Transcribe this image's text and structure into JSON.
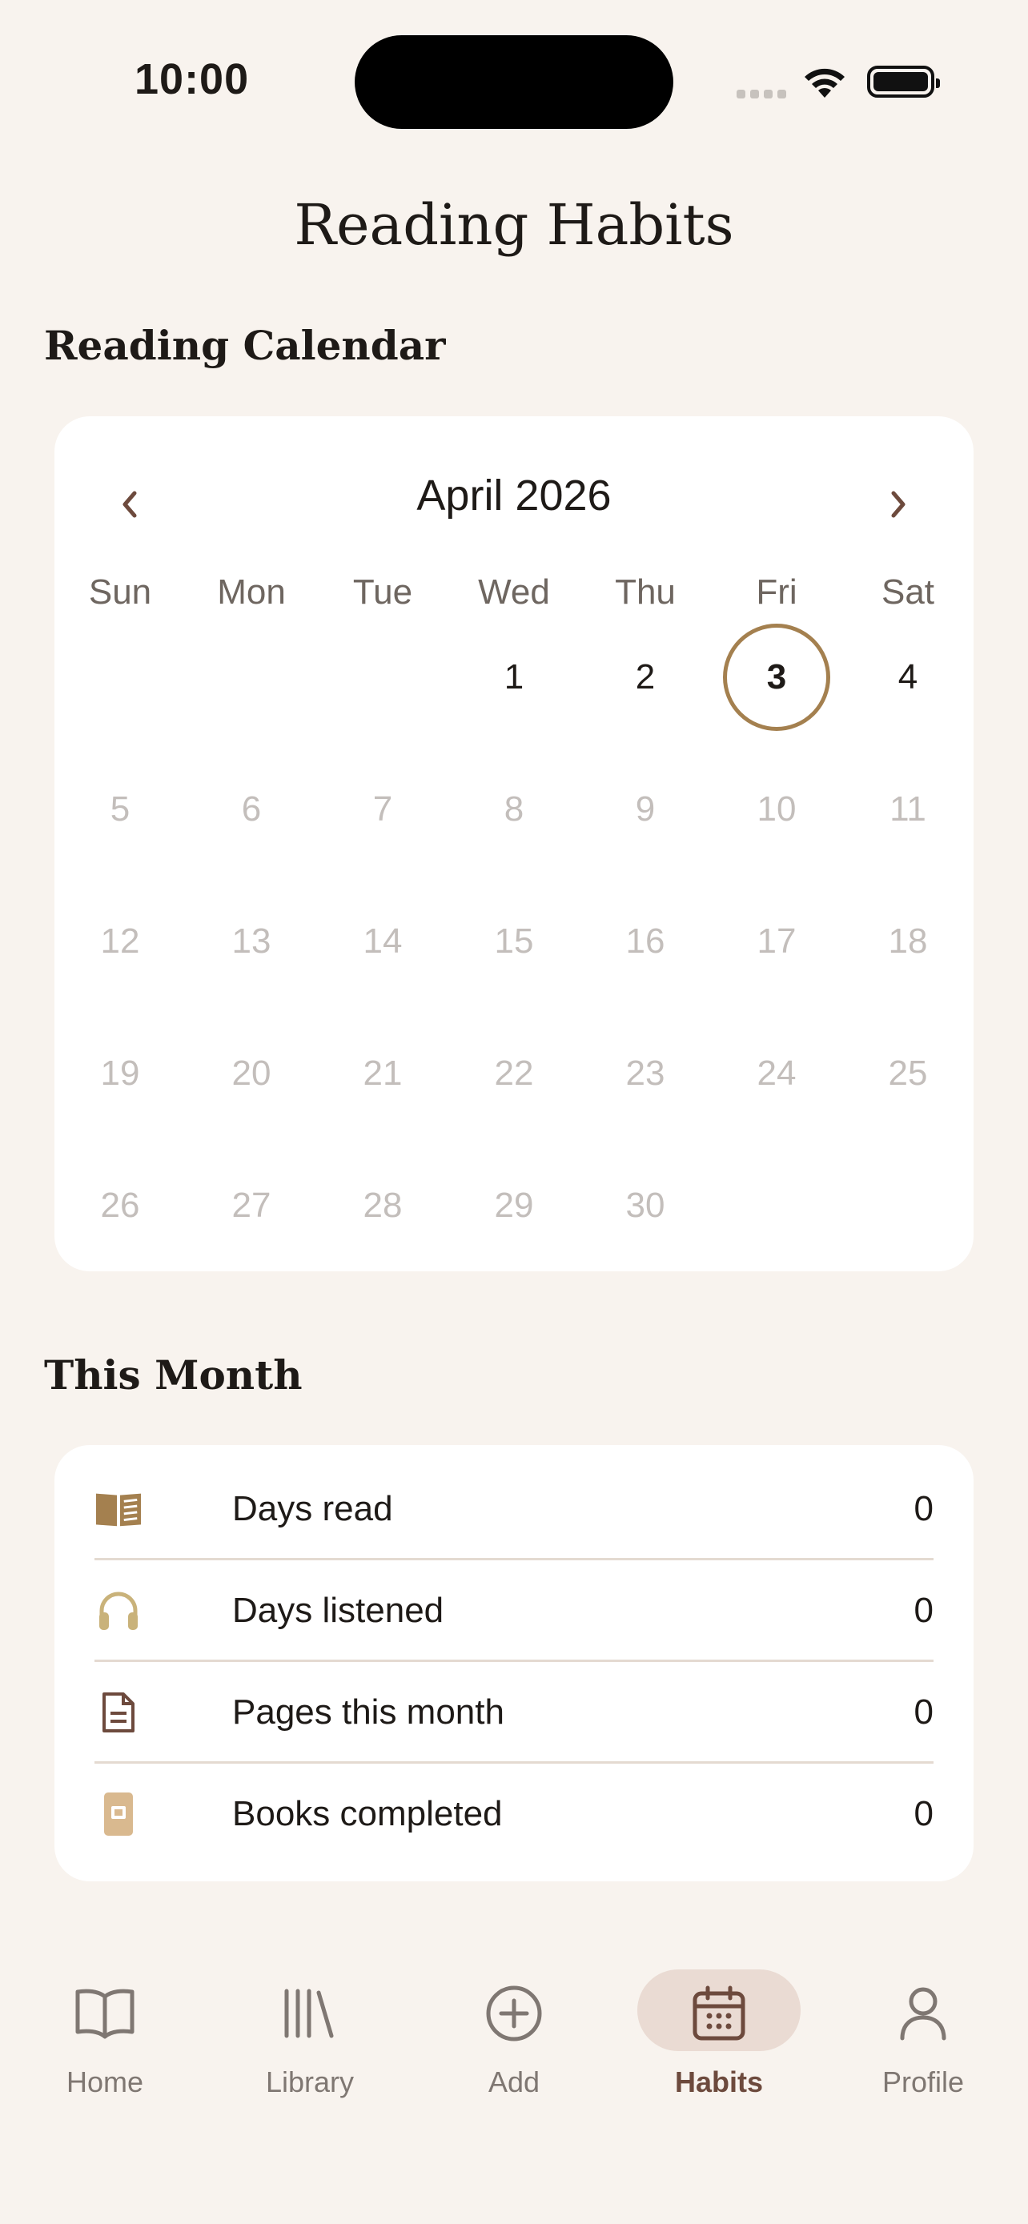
{
  "status_bar": {
    "time": "10:00"
  },
  "page": {
    "title": "Reading Habits"
  },
  "calendar": {
    "section_title": "Reading Calendar",
    "month_label": "April 2026",
    "weekdays": [
      "Sun",
      "Mon",
      "Tue",
      "Wed",
      "Thu",
      "Fri",
      "Sat"
    ],
    "days": [
      "1",
      "2",
      "3",
      "4",
      "5",
      "6",
      "7",
      "8",
      "9",
      "10",
      "11",
      "12",
      "13",
      "14",
      "15",
      "16",
      "17",
      "18",
      "19",
      "20",
      "21",
      "22",
      "23",
      "24",
      "25",
      "26",
      "27",
      "28",
      "29",
      "30"
    ],
    "first_weekday_index": 3,
    "today": "3",
    "active_through": "4",
    "today_ring_color": "#a4804f"
  },
  "stats": {
    "section_title": "This Month",
    "items": [
      {
        "icon": "open-book-icon",
        "label": "Days read",
        "value": "0",
        "color": "#a4804f"
      },
      {
        "icon": "headphones-icon",
        "label": "Days listened",
        "value": "0",
        "color": "#c9b27a"
      },
      {
        "icon": "document-icon",
        "label": "Pages this month",
        "value": "0",
        "color": "#6d4a3d"
      },
      {
        "icon": "closed-book-icon",
        "label": "Books completed",
        "value": "0",
        "color": "#d9b98f"
      }
    ]
  },
  "tabbar": {
    "items": [
      {
        "label": "Home",
        "icon": "book-outline-icon"
      },
      {
        "label": "Library",
        "icon": "library-icon"
      },
      {
        "label": "Add",
        "icon": "plus-circle-icon"
      },
      {
        "label": "Habits",
        "icon": "calendar-icon",
        "selected": true
      },
      {
        "label": "Profile",
        "icon": "person-icon"
      }
    ],
    "accent": "#6d4a3d"
  }
}
